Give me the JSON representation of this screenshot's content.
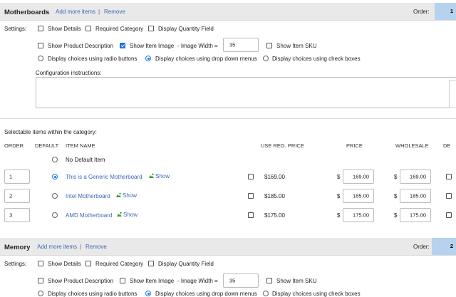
{
  "categories": [
    {
      "title": "Motherboards",
      "add_link": "Add more items",
      "separator": "|",
      "remove_link": "Remove",
      "order_label": "Order:",
      "order_value": "1"
    },
    {
      "title": "Memory",
      "add_link": "Add more items",
      "separator": "|",
      "remove_link": "Remove",
      "order_label": "Order:",
      "order_value": "2"
    }
  ],
  "settings": {
    "label": "Settings:",
    "show_details": "Show Details",
    "required_category": "Required Category",
    "display_quantity_field": "Display Quantity Field",
    "show_product_description": "Show Product Description",
    "show_item_image": "Show Item Image",
    "image_width_label": "- Image Width =",
    "image_width_value": "35",
    "show_item_sku": "Show Item SKU",
    "radio_buttons": "Display choices using radio buttons",
    "drop_down": "Display choices using drop down menus",
    "check_boxes": "Display choices using check boxes",
    "config_instructions": "Configuration instructions:"
  },
  "items_table": {
    "caption": "Selectable items within the category:",
    "headers": {
      "order": "ORDER",
      "default": "DEFAULT",
      "item_name": "ITEM NAME",
      "use_reg_price": "USE REG. PRICE",
      "price": "PRICE",
      "wholesale": "WHOLESALE",
      "cut": "DE"
    },
    "no_default": "No Default Item",
    "show_link": "Show",
    "currency": "$",
    "rows": [
      {
        "order": "1",
        "name": "This is a Generic Motherboard",
        "reg_price": "$169.00",
        "price": "169.00",
        "wholesale": "169.00"
      },
      {
        "order": "2",
        "name": "Intel Motherboard",
        "reg_price": "$185.00",
        "price": "185.00",
        "wholesale": "185.00"
      },
      {
        "order": "3",
        "name": "AMD Motherboard",
        "reg_price": "$175.00",
        "price": "175.00",
        "wholesale": "175.00"
      }
    ]
  },
  "colors": {
    "link": "#3a6bb4",
    "accent": "#1a73e8",
    "order_box": "#b6d2ee",
    "show_icon": "#3c9a3c"
  }
}
